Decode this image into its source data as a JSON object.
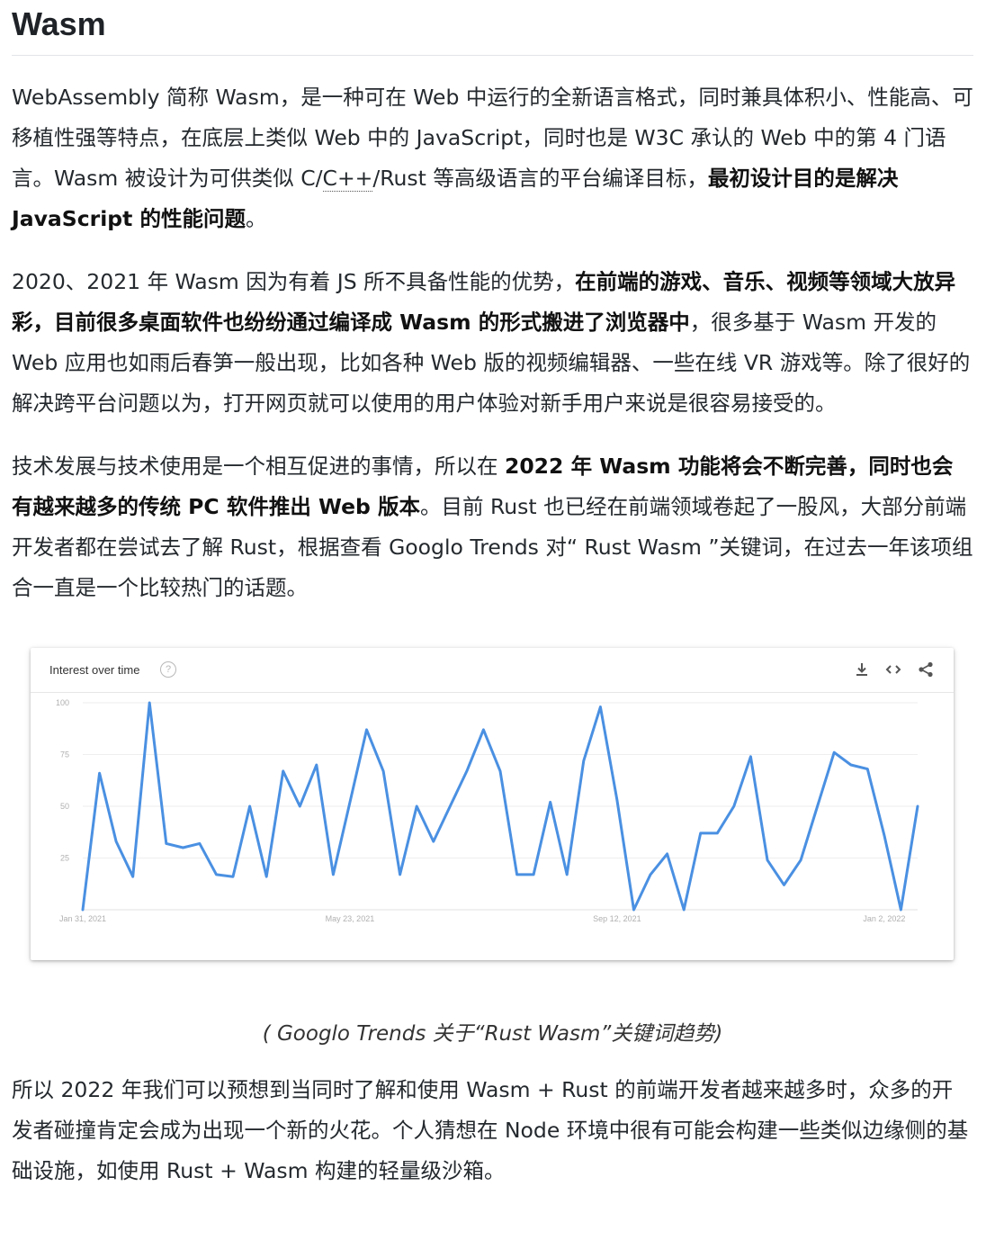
{
  "article": {
    "heading": "Wasm",
    "p1": {
      "t1": "WebAssembly 简称 Wasm，是一种可在 Web 中运行的全新语言格式，同时兼具体积小、性能高、可移植性强等特点，在底层上类似 Web 中的 JavaScript，同时也是 W3C 承认的 Web 中的第 4 门语言。Wasm 被设计为可供类似 C/",
      "abbr": "C++",
      "t2": "/Rust 等高级语言的平台编译目标，",
      "bold": "最初设计目的是解决 JavaScript 的性能问题",
      "t3": "。"
    },
    "p2": {
      "t1": "2020、2021 年 Wasm 因为有着 JS 所不具备性能的优势，",
      "bold": "在前端的游戏、音乐、视频等领域大放异彩，目前很多桌面软件也纷纷通过编译成 Wasm 的形式搬进了浏览器中",
      "t2": "，很多基于 Wasm 开发的 Web 应用也如雨后春笋一般出现，比如各种 Web 版的视频编辑器、一些在线 VR 游戏等。除了很好的解决跨平台问题以为，打开网页就可以使用的用户体验对新手用户来说是很容易接受的。"
    },
    "p3": {
      "t1": "技术发展与技术使用是一个相互促进的事情，所以在 ",
      "bold": "2022 年 Wasm 功能将会不断完善，同时也会有越来越多的传统 PC 软件推出 Web 版本",
      "t2": "。目前 Rust 也已经在前端领域卷起了一股风，大部分前端开发者都在尝试去了解 Rust，根据查看 Googlo Trends 对“ Rust Wasm ”关键词，在过去一年该项组合一直是一个比较热门的话题。"
    },
    "caption": "( Googlo Trends 关于“Rust Wasm”关键词趋势)",
    "p4": "所以 2022 年我们可以预想到当同时了解和使用 Wasm + Rust 的前端开发者越来越多时，众多的开发者碰撞肯定会成为出现一个新的火花。个人猜想在 Node 环境中很有可能会构建一些类似边缘侧的基础设施，如使用 Rust + Wasm 构建的轻量级沙箱。"
  },
  "widget": {
    "title": "Interest over time",
    "help_glyph": "?",
    "icons": [
      "download-icon",
      "embed-code-icon",
      "share-icon"
    ]
  },
  "colors": {
    "line": "#4a90e2",
    "text": "#24292e",
    "grid": "#eeeeee",
    "axis_text": "#b0b0b0"
  },
  "chart_data": {
    "type": "line",
    "title": "Interest over time",
    "xlabel": "",
    "ylabel": "",
    "ylim": [
      0,
      100
    ],
    "yticks": [
      25,
      50,
      75,
      100
    ],
    "ytick_labels": [
      "25",
      "50",
      "75",
      "100"
    ],
    "xtick_labels": [
      {
        "index": 0,
        "label": "Jan 31, 2021"
      },
      {
        "index": 16,
        "label": "May 23, 2021"
      },
      {
        "index": 32,
        "label": "Sep 12, 2021"
      },
      {
        "index": 48,
        "label": "Jan 2, 2022"
      }
    ],
    "grid": true,
    "legend": "none",
    "series": [
      {
        "values": [
          0,
          66,
          33,
          16,
          100,
          32,
          30,
          32,
          17,
          16,
          50,
          16,
          67,
          50,
          70,
          17,
          52,
          87,
          67,
          17,
          50,
          33,
          50,
          67,
          87,
          67,
          17,
          17,
          52,
          17,
          72,
          98,
          53,
          0,
          17,
          27,
          0,
          37,
          37,
          50,
          74,
          24,
          12,
          24,
          50,
          76,
          70,
          68,
          36,
          0,
          50
        ]
      }
    ]
  }
}
